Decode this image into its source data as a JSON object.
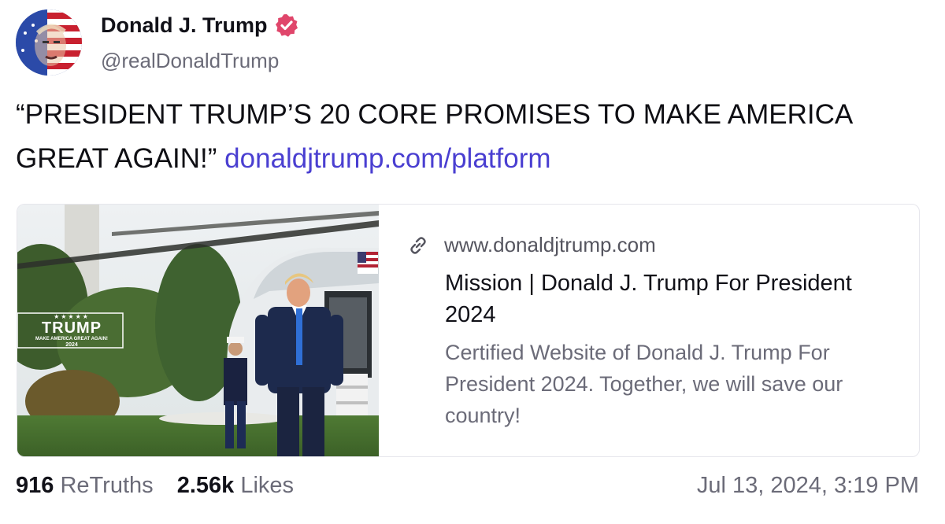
{
  "author": {
    "display_name": "Donald J. Trump",
    "handle": "@realDonaldTrump",
    "verified": true,
    "verified_color": "#e0466b"
  },
  "post": {
    "text": "“PRESIDENT TRUMP’S 20 CORE PROMISES TO MAKE AMERICA GREAT AGAIN!”",
    "link_text": "donaldjtrump.com/platform",
    "link_color": "#4a3fd1"
  },
  "link_card": {
    "domain": "www.donaldjtrump.com",
    "title": "Mission | Donald J. Trump For President 2024",
    "description": "Certified Website of Donald J. Trump For President 2024. Together, we will save our country!",
    "image_logo_text": "TRUMP",
    "image_logo_tagline": "MAKE AMERICA GREAT AGAIN!",
    "image_logo_year": "2024",
    "image_logo_stars": "★★★★★"
  },
  "stats": {
    "retruths_count": "916",
    "retruths_label": "ReTruths",
    "likes_count": "2.56k",
    "likes_label": "Likes"
  },
  "timestamp": "Jul 13, 2024, 3:19 PM"
}
